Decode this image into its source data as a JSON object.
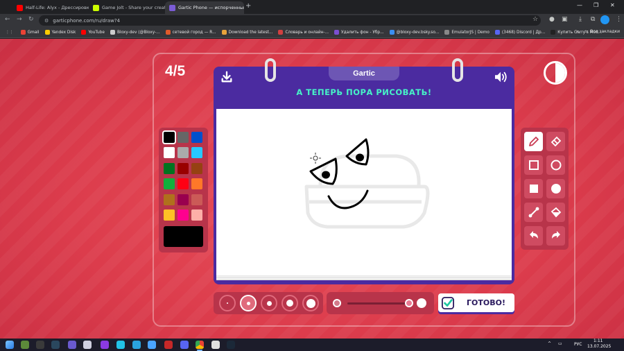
{
  "browser": {
    "tabs": [
      {
        "title": "Half-Life: Alyx - Дрессировка ·",
        "favicon": "youtube-icon",
        "color": "#ff0000",
        "active": false
      },
      {
        "title": "Game Jolt - Share your creatio",
        "favicon": "gamejolt-icon",
        "color": "#ccff00",
        "active": false
      },
      {
        "title": "Gartic Phone — испорченный",
        "favicon": "gartic-icon",
        "color": "#7b5cd6",
        "active": true
      }
    ],
    "url": "garticphone.com/ru/draw?4",
    "bookmarks": [
      {
        "label": "Gmail",
        "color": "#ea4335"
      },
      {
        "label": "Yandex Disk",
        "color": "#ffcc00"
      },
      {
        "label": "YouTube",
        "color": "#ff0000"
      },
      {
        "label": "Bloxy-dev (@Bloxy-...",
        "color": "#cccccc"
      },
      {
        "label": "сетевой город — R...",
        "color": "#e05a2a"
      },
      {
        "label": "Download the latest...",
        "color": "#e8a33b"
      },
      {
        "label": "Словарь и онлайн-...",
        "color": "#d04040"
      },
      {
        "label": "Удалить фон - Убр...",
        "color": "#7b4fd0"
      },
      {
        "label": "@bloxy-dev.bsky.so...",
        "color": "#3b8ef0"
      },
      {
        "label": "EmulatorJS | Demo",
        "color": "#888888"
      },
      {
        "label": "(3468) Discord | Др...",
        "color": "#5865f2"
      },
      {
        "label": "Купить Garry's Mod...",
        "color": "#222222"
      }
    ],
    "all_bookmarks_label": "Все закладки"
  },
  "game": {
    "round": "4/5",
    "logo": "Gartic",
    "title": "А ТЕПЕРЬ ПОРА РИСОВАТЬ!",
    "done_label": "ГОТОВО!",
    "colors": [
      "#000000",
      "#666666",
      "#0050cd",
      "#ffffff",
      "#aaaaaa",
      "#26c9ff",
      "#017420",
      "#990000",
      "#964112",
      "#11b03c",
      "#ff0013",
      "#ff7829",
      "#b0701c",
      "#99004e",
      "#cb5a57",
      "#ffc126",
      "#ff008f",
      "#feafa8"
    ],
    "selected_color": "#000000",
    "tools": [
      "pencil-icon",
      "eraser-icon",
      "square-outline-icon",
      "circle-outline-icon",
      "square-filled-icon",
      "circle-filled-icon",
      "line-icon",
      "fill-bucket-icon",
      "undo-icon",
      "redo-icon"
    ],
    "selected_tool": "pencil-icon",
    "brush_sizes": 5,
    "selected_size_index": 1
  },
  "taskbar": {
    "language": "РУС",
    "time": "1:11",
    "date": "13.07.2025"
  }
}
